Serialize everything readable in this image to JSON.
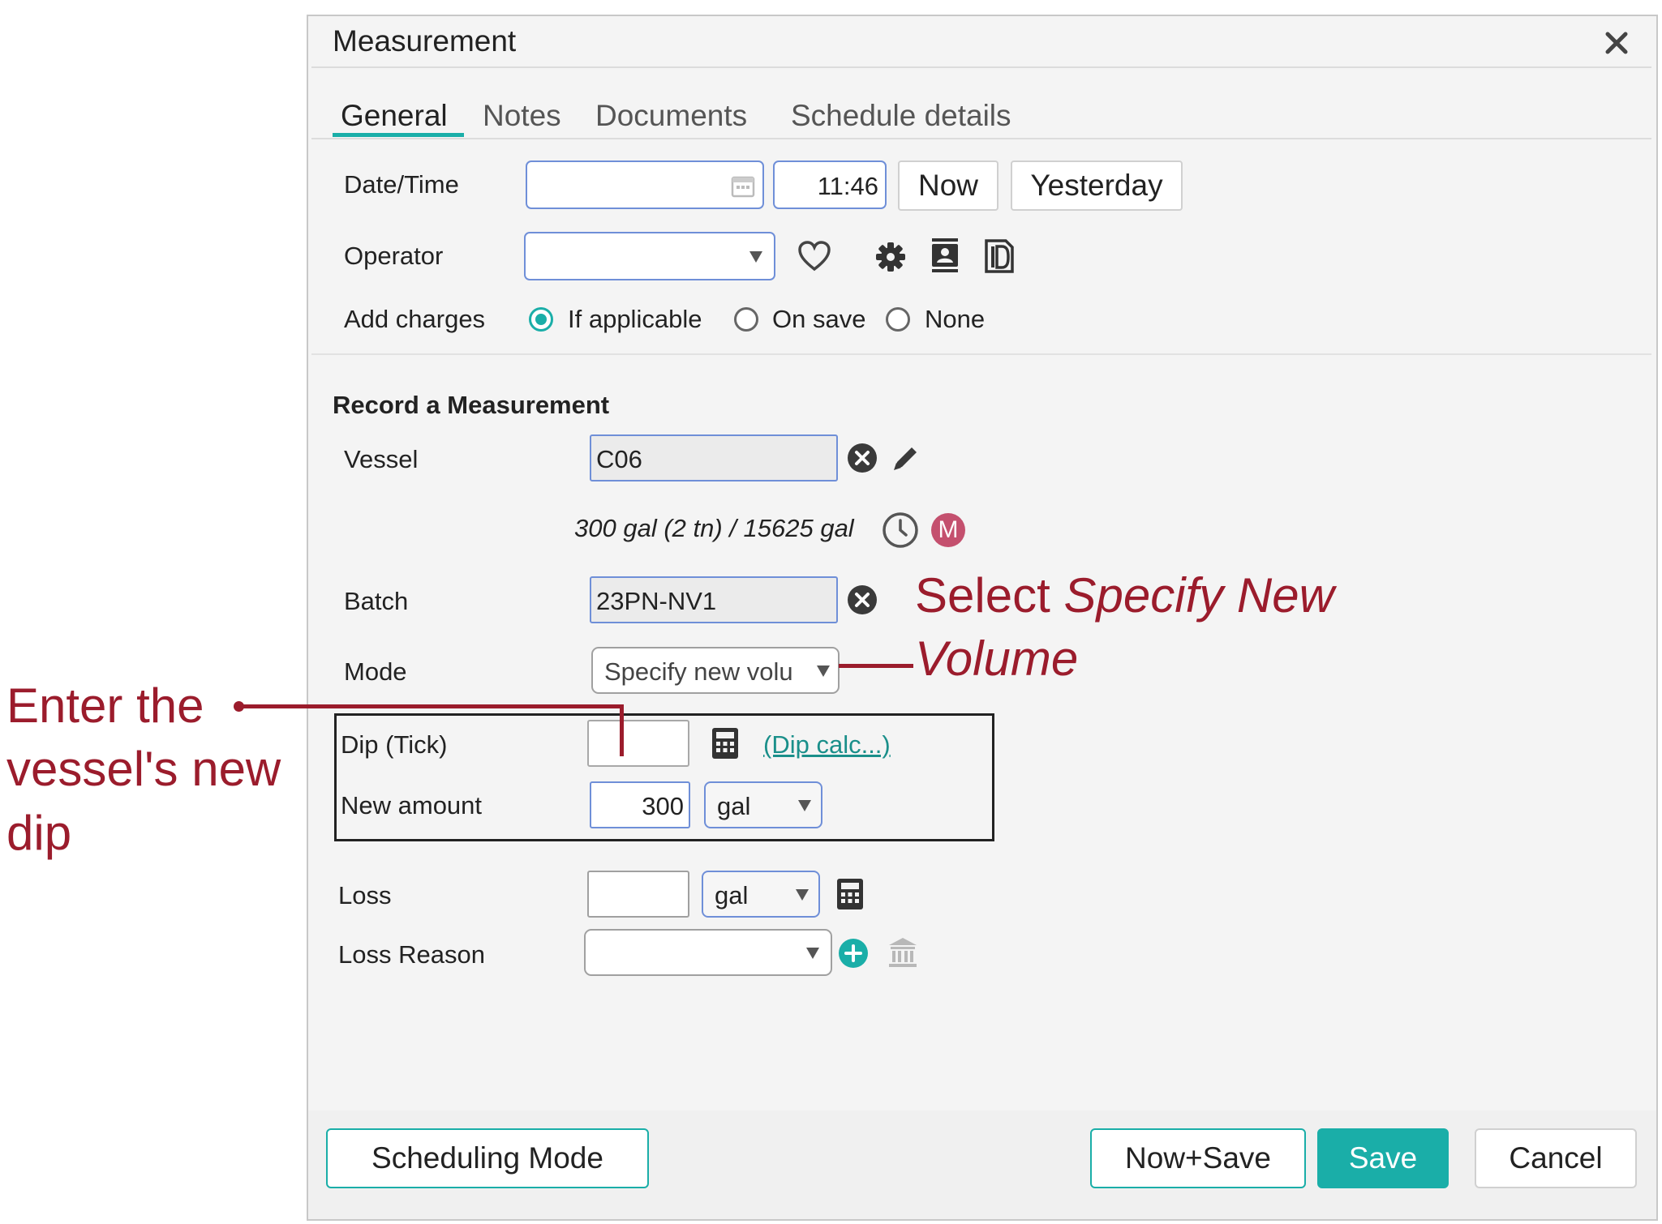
{
  "dialog": {
    "title": "Measurement"
  },
  "tabs": [
    {
      "label": "General",
      "active": true
    },
    {
      "label": "Notes"
    },
    {
      "label": "Documents"
    },
    {
      "label": "Schedule details"
    }
  ],
  "general": {
    "datetime_label": "Date/Time",
    "date_value": "",
    "time_value": "11:46",
    "now_button": "Now",
    "yesterday_button": "Yesterday",
    "operator_label": "Operator",
    "operator_value": "",
    "add_charges_label": "Add charges",
    "charges_options": [
      "If applicable",
      "On save",
      "None"
    ],
    "charges_selected": "If applicable"
  },
  "record": {
    "heading": "Record a Measurement",
    "vessel_label": "Vessel",
    "vessel_value": "C06",
    "vessel_info": "300 gal (2 tn) / 15625 gal",
    "badge_letter": "M",
    "batch_label": "Batch",
    "batch_value": "23PN-NV1",
    "mode_label": "Mode",
    "mode_value": "Specify new volu",
    "dip_label": "Dip (Tick)",
    "dip_value": "",
    "dip_calc_link": "(Dip calc...)",
    "new_amount_label": "New amount",
    "new_amount_value": "300",
    "new_amount_unit": "gal",
    "loss_label": "Loss",
    "loss_value": "",
    "loss_unit": "gal",
    "loss_reason_label": "Loss Reason",
    "loss_reason_value": ""
  },
  "footer": {
    "scheduling_mode": "Scheduling Mode",
    "now_save": "Now+Save",
    "save": "Save",
    "cancel": "Cancel"
  },
  "annotations": {
    "left_line1": "Enter the",
    "left_line2": "vessel's new",
    "left_line3": "dip",
    "right_prefix": "Select ",
    "right_italic_1": "Specify New",
    "right_italic_2": "Volume"
  },
  "colors": {
    "accent": "#1aaea8",
    "annotation": "#9b1c2c",
    "field_border": "#6f8fd8",
    "badge": "#c4506e"
  }
}
